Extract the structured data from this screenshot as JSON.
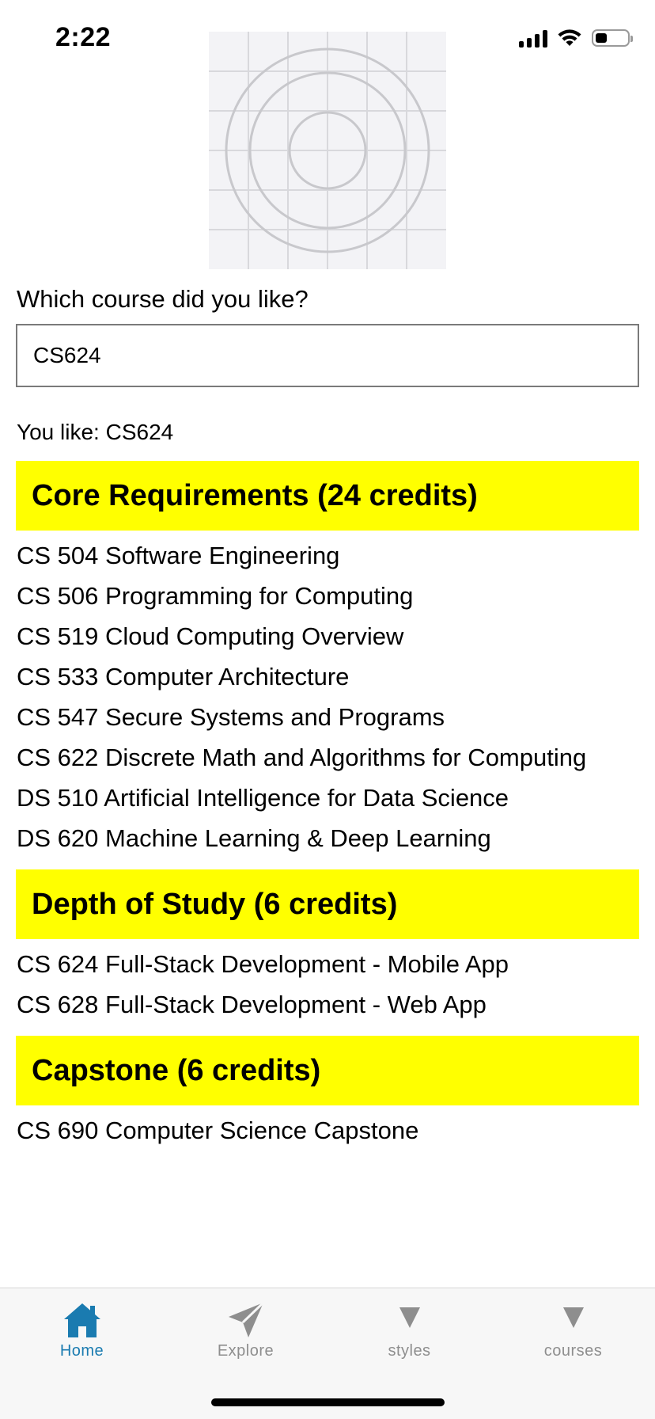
{
  "status_bar": {
    "time": "2:22"
  },
  "prompt": {
    "label": "Which course did you like?",
    "input_value": "CS624",
    "you_like_text": "You like: CS624"
  },
  "sections": [
    {
      "title": "Core Requirements (24 credits)",
      "courses": [
        "CS 504 Software Engineering",
        "CS 506 Programming for Computing",
        "CS 519 Cloud Computing Overview",
        "CS 533 Computer Architecture",
        "CS 547 Secure Systems and Programs",
        "CS 622 Discrete Math and Algorithms for Computing",
        "DS 510 Artificial Intelligence for Data Science",
        "DS 620 Machine Learning & Deep Learning"
      ]
    },
    {
      "title": "Depth of Study (6 credits)",
      "courses": [
        "CS 624 Full-Stack Development - Mobile App",
        "CS 628 Full-Stack Development - Web App"
      ]
    },
    {
      "title": "Capstone (6 credits)",
      "courses": [
        "CS 690 Computer Science Capstone"
      ]
    }
  ],
  "tab_bar": {
    "tabs": [
      {
        "label": "Home",
        "icon": "home-icon",
        "active": true
      },
      {
        "label": "Explore",
        "icon": "paper-plane-icon",
        "active": false
      },
      {
        "label": "styles",
        "icon": "triangle-down-icon",
        "active": false
      },
      {
        "label": "courses",
        "icon": "triangle-down-icon",
        "active": false
      }
    ],
    "active_color": "#1a7bb0",
    "inactive_color": "#8e8e8e"
  },
  "colors": {
    "section_header_bg": "#ffff00"
  }
}
